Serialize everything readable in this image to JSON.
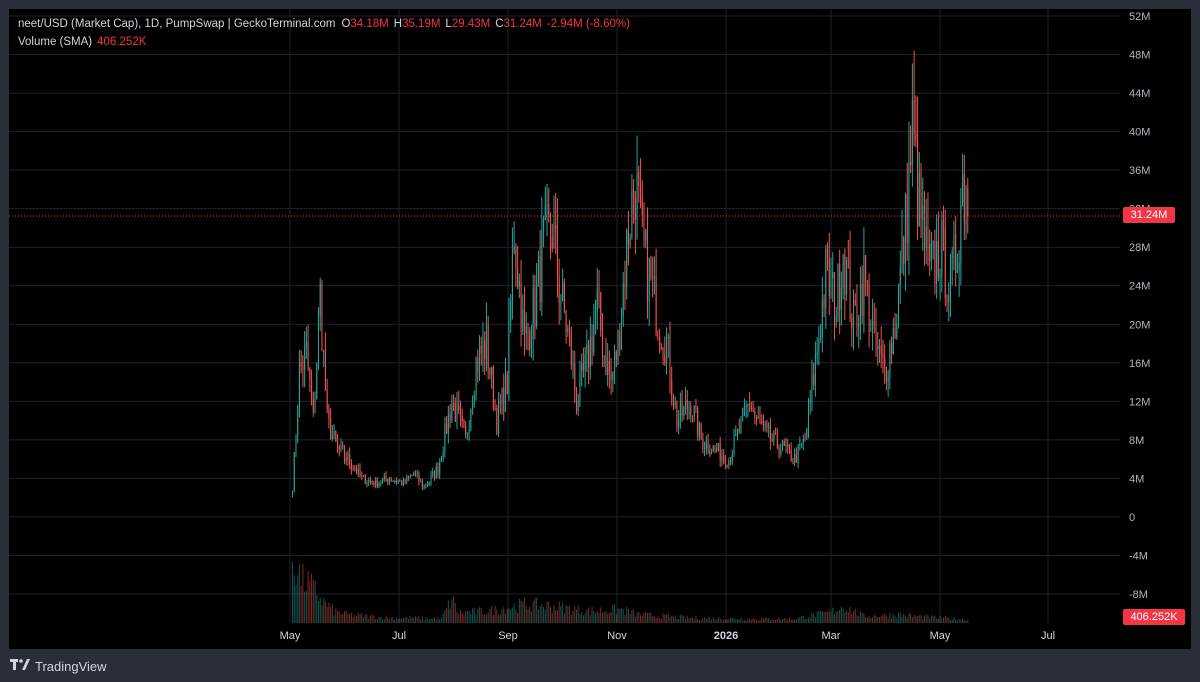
{
  "header": {
    "symbol": "neet/USD (Market Cap), 1D, PumpSwap | GeckoTerminal.com",
    "o_label": "O",
    "o_value": "34.18M",
    "h_label": "H",
    "h_value": "35.19M",
    "l_label": "L",
    "l_value": "29.43M",
    "c_label": "C",
    "c_value": "31.24M",
    "change": "-2.94M (-8.60%)",
    "volume_label": "Volume (SMA)",
    "volume_value": "406.252K"
  },
  "price_tag": "31.24M",
  "volume_tag": "406.252K",
  "footer": {
    "brand": "TradingView",
    "logo_icon": "tradingview-logo-icon"
  },
  "colors": {
    "up": "#26a69a",
    "down": "#ef5350",
    "background": "#000000",
    "grid": "#1f222b",
    "text": "#d1d4dc",
    "last_price": "#f23645"
  },
  "chart_data": {
    "type": "candlestick",
    "title": "neet/USD (Market Cap), 1D, PumpSwap | GeckoTerminal.com",
    "y_ticks": [
      "52M",
      "48M",
      "44M",
      "40M",
      "36M",
      "32M",
      "28M",
      "24M",
      "20M",
      "16M",
      "12M",
      "8M",
      "4M",
      "0",
      "-4M",
      "-8M"
    ],
    "y_range_millions": [
      -8,
      52
    ],
    "x_ticks": [
      "May",
      "Jul",
      "Sep",
      "Nov",
      "2026",
      "Mar",
      "May",
      "Jul"
    ],
    "last_close_millions": 31.24,
    "grid": true,
    "close_millions_anchors": [
      [
        0,
        3
      ],
      [
        4,
        15
      ],
      [
        8,
        17
      ],
      [
        12,
        10
      ],
      [
        16,
        23
      ],
      [
        20,
        10
      ],
      [
        26,
        7
      ],
      [
        32,
        6
      ],
      [
        40,
        4
      ],
      [
        48,
        3.5
      ],
      [
        56,
        4
      ],
      [
        64,
        3.5
      ],
      [
        70,
        4.5
      ],
      [
        76,
        3
      ],
      [
        84,
        5
      ],
      [
        92,
        12
      ],
      [
        100,
        8
      ],
      [
        106,
        16
      ],
      [
        112,
        18
      ],
      [
        118,
        10
      ],
      [
        124,
        14
      ],
      [
        128,
        30
      ],
      [
        134,
        18
      ],
      [
        140,
        22
      ],
      [
        145,
        28
      ],
      [
        150,
        30
      ],
      [
        154,
        24
      ],
      [
        160,
        18
      ],
      [
        164,
        12
      ],
      [
        170,
        16
      ],
      [
        176,
        22
      ],
      [
        180,
        17
      ],
      [
        184,
        14
      ],
      [
        188,
        18
      ],
      [
        194,
        30
      ],
      [
        198,
        35
      ],
      [
        202,
        28
      ],
      [
        206,
        25
      ],
      [
        212,
        20
      ],
      [
        216,
        18
      ],
      [
        222,
        10
      ],
      [
        230,
        12
      ],
      [
        236,
        8
      ],
      [
        244,
        7
      ],
      [
        252,
        6
      ],
      [
        258,
        9
      ],
      [
        264,
        12
      ],
      [
        268,
        10
      ],
      [
        276,
        8
      ],
      [
        284,
        7
      ],
      [
        290,
        6
      ],
      [
        296,
        8
      ],
      [
        302,
        16
      ],
      [
        308,
        25
      ],
      [
        314,
        22
      ],
      [
        318,
        28
      ],
      [
        324,
        20
      ],
      [
        330,
        25
      ],
      [
        336,
        18
      ],
      [
        342,
        15
      ],
      [
        348,
        20
      ],
      [
        354,
        30
      ],
      [
        358,
        40
      ],
      [
        362,
        32
      ],
      [
        368,
        25
      ],
      [
        374,
        28
      ],
      [
        380,
        24
      ],
      [
        384,
        28
      ],
      [
        387,
        35
      ],
      [
        390,
        31.24
      ]
    ],
    "volume_anchors": [
      [
        0,
        80
      ],
      [
        3,
        60
      ],
      [
        6,
        50
      ],
      [
        10,
        45
      ],
      [
        14,
        35
      ],
      [
        18,
        25
      ],
      [
        24,
        14
      ],
      [
        32,
        10
      ],
      [
        44,
        8
      ],
      [
        56,
        6
      ],
      [
        70,
        6
      ],
      [
        86,
        5
      ],
      [
        92,
        28
      ],
      [
        96,
        12
      ],
      [
        112,
        14
      ],
      [
        124,
        18
      ],
      [
        134,
        22
      ],
      [
        150,
        20
      ],
      [
        170,
        14
      ],
      [
        190,
        16
      ],
      [
        200,
        10
      ],
      [
        230,
        6
      ],
      [
        260,
        5
      ],
      [
        290,
        5
      ],
      [
        300,
        9
      ],
      [
        310,
        12
      ],
      [
        318,
        20
      ],
      [
        330,
        8
      ],
      [
        350,
        10
      ],
      [
        360,
        8
      ],
      [
        375,
        6
      ],
      [
        390,
        4
      ]
    ],
    "volume_sma_last": "406.252K"
  }
}
